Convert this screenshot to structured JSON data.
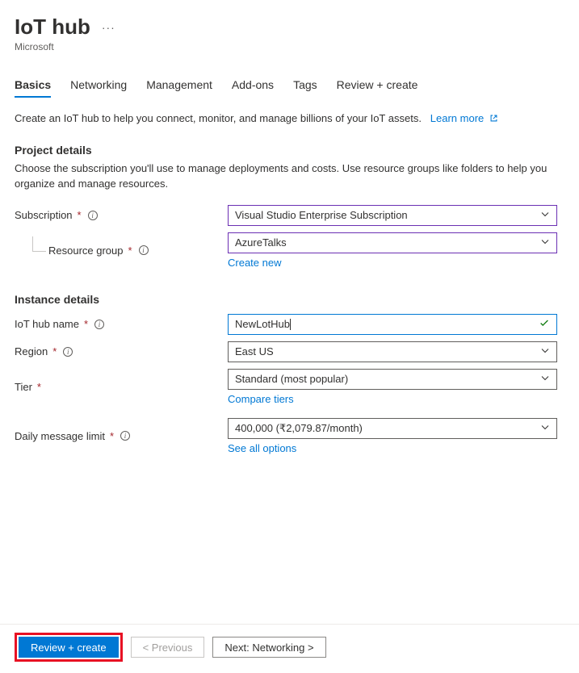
{
  "header": {
    "title": "IoT hub",
    "publisher": "Microsoft"
  },
  "tabs": [
    {
      "label": "Basics",
      "active": true
    },
    {
      "label": "Networking",
      "active": false
    },
    {
      "label": "Management",
      "active": false
    },
    {
      "label": "Add-ons",
      "active": false
    },
    {
      "label": "Tags",
      "active": false
    },
    {
      "label": "Review + create",
      "active": false
    }
  ],
  "intro": {
    "text": "Create an IoT hub to help you connect, monitor, and manage billions of your IoT assets.",
    "learn_more": "Learn more"
  },
  "project": {
    "heading": "Project details",
    "desc": "Choose the subscription you'll use to manage deployments and costs. Use resource groups like folders to help you organize and manage resources.",
    "subscription_label": "Subscription",
    "subscription_value": "Visual Studio Enterprise Subscription",
    "resource_group_label": "Resource group",
    "resource_group_value": "AzureTalks",
    "create_new": "Create new"
  },
  "instance": {
    "heading": "Instance details",
    "name_label": "IoT hub name",
    "name_value": "NewLotHub",
    "region_label": "Region",
    "region_value": "East US",
    "tier_label": "Tier",
    "tier_value": "Standard (most popular)",
    "compare_tiers": "Compare tiers",
    "daily_limit_label": "Daily message limit",
    "daily_limit_value": "400,000 (₹2,079.87/month)",
    "see_all": "See all options"
  },
  "footer": {
    "review": "Review + create",
    "previous": "< Previous",
    "next": "Next: Networking >"
  }
}
